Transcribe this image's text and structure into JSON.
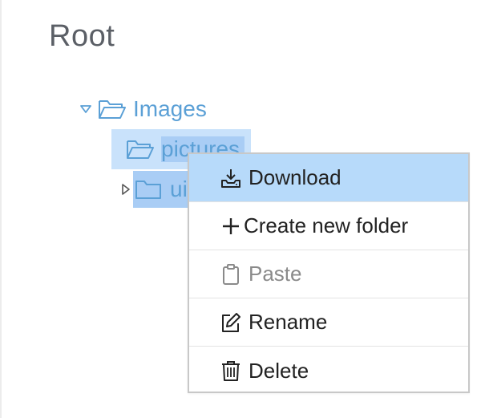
{
  "page": {
    "title": "Root"
  },
  "tree": {
    "images_label": "Images",
    "pictures_label": "pictures",
    "ui_label": "ui"
  },
  "context_menu": {
    "items": [
      {
        "label": "Download",
        "icon": "download-icon"
      },
      {
        "label": "Create new folder",
        "icon": "plus-icon"
      },
      {
        "label": "Paste",
        "icon": "clipboard-icon",
        "disabled": true
      },
      {
        "label": "Rename",
        "icon": "edit-icon"
      },
      {
        "label": "Delete",
        "icon": "trash-icon"
      }
    ]
  },
  "colors": {
    "tree_text": "#5ba0d6",
    "selection": "#c9e2fb",
    "menu_active": "#b7dafa"
  }
}
